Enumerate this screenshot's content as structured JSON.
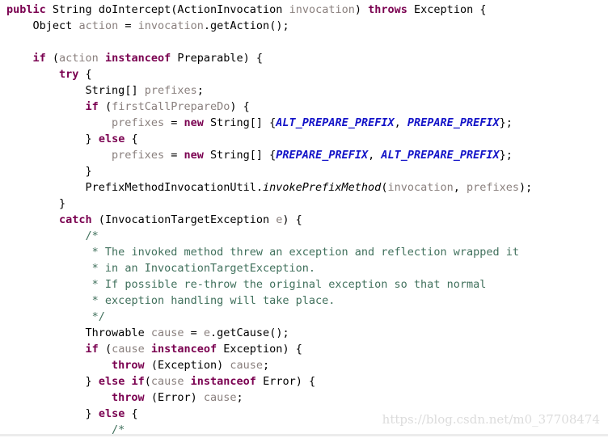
{
  "editor": {
    "language": "Java",
    "background": "#ffffff"
  },
  "theme": {
    "keyword": "#7a0050",
    "type": "#000000",
    "identifier": "#8a807e",
    "constant": "#1414c8",
    "comment": "#40705c",
    "punctuation": "#000000",
    "watermark": "#dcdcdc"
  },
  "watermark": {
    "text": "https://blog.csdn.net/m0_37708474"
  },
  "code": {
    "lines": [
      {
        "indent": 0,
        "tokens": [
          {
            "cls": "t-kw",
            "text": "public"
          },
          {
            "cls": "t-punc",
            "text": " "
          },
          {
            "cls": "t-type",
            "text": "String"
          },
          {
            "cls": "t-punc",
            "text": " "
          },
          {
            "cls": "t-type",
            "text": "doIntercept"
          },
          {
            "cls": "t-punc",
            "text": "("
          },
          {
            "cls": "t-type",
            "text": "ActionInvocation"
          },
          {
            "cls": "t-punc",
            "text": " "
          },
          {
            "cls": "t-ident",
            "text": "invocation"
          },
          {
            "cls": "t-punc",
            "text": ") "
          },
          {
            "cls": "t-kw",
            "text": "throws"
          },
          {
            "cls": "t-punc",
            "text": " "
          },
          {
            "cls": "t-type",
            "text": "Exception"
          },
          {
            "cls": "t-punc",
            "text": " {"
          }
        ]
      },
      {
        "indent": 4,
        "tokens": [
          {
            "cls": "t-type",
            "text": "Object"
          },
          {
            "cls": "t-punc",
            "text": " "
          },
          {
            "cls": "t-ident",
            "text": "action"
          },
          {
            "cls": "t-punc",
            "text": " = "
          },
          {
            "cls": "t-ident",
            "text": "invocation"
          },
          {
            "cls": "t-punc",
            "text": "."
          },
          {
            "cls": "t-type",
            "text": "getAction"
          },
          {
            "cls": "t-punc",
            "text": "();"
          }
        ]
      },
      {
        "indent": 0,
        "tokens": []
      },
      {
        "indent": 4,
        "tokens": [
          {
            "cls": "t-kw",
            "text": "if"
          },
          {
            "cls": "t-punc",
            "text": " ("
          },
          {
            "cls": "t-ident",
            "text": "action"
          },
          {
            "cls": "t-punc",
            "text": " "
          },
          {
            "cls": "t-kw",
            "text": "instanceof"
          },
          {
            "cls": "t-punc",
            "text": " "
          },
          {
            "cls": "t-type",
            "text": "Preparable"
          },
          {
            "cls": "t-punc",
            "text": ") {"
          }
        ]
      },
      {
        "indent": 8,
        "tokens": [
          {
            "cls": "t-kw",
            "text": "try"
          },
          {
            "cls": "t-punc",
            "text": " {"
          }
        ]
      },
      {
        "indent": 12,
        "tokens": [
          {
            "cls": "t-type",
            "text": "String"
          },
          {
            "cls": "t-punc",
            "text": "[] "
          },
          {
            "cls": "t-ident",
            "text": "prefixes"
          },
          {
            "cls": "t-punc",
            "text": ";"
          }
        ]
      },
      {
        "indent": 12,
        "tokens": [
          {
            "cls": "t-kw",
            "text": "if"
          },
          {
            "cls": "t-punc",
            "text": " ("
          },
          {
            "cls": "t-ident",
            "text": "firstCallPrepareDo"
          },
          {
            "cls": "t-punc",
            "text": ") {"
          }
        ]
      },
      {
        "indent": 16,
        "tokens": [
          {
            "cls": "t-ident",
            "text": "prefixes"
          },
          {
            "cls": "t-punc",
            "text": " = "
          },
          {
            "cls": "t-kw",
            "text": "new"
          },
          {
            "cls": "t-punc",
            "text": " "
          },
          {
            "cls": "t-type",
            "text": "String"
          },
          {
            "cls": "t-punc",
            "text": "[] {"
          },
          {
            "cls": "t-const",
            "text": "ALT_PREPARE_PREFIX"
          },
          {
            "cls": "t-punc",
            "text": ", "
          },
          {
            "cls": "t-const",
            "text": "PREPARE_PREFIX"
          },
          {
            "cls": "t-punc",
            "text": "};"
          }
        ]
      },
      {
        "indent": 12,
        "tokens": [
          {
            "cls": "t-punc",
            "text": "} "
          },
          {
            "cls": "t-kw",
            "text": "else"
          },
          {
            "cls": "t-punc",
            "text": " {"
          }
        ]
      },
      {
        "indent": 16,
        "tokens": [
          {
            "cls": "t-ident",
            "text": "prefixes"
          },
          {
            "cls": "t-punc",
            "text": " = "
          },
          {
            "cls": "t-kw",
            "text": "new"
          },
          {
            "cls": "t-punc",
            "text": " "
          },
          {
            "cls": "t-type",
            "text": "String"
          },
          {
            "cls": "t-punc",
            "text": "[] {"
          },
          {
            "cls": "t-const",
            "text": "PREPARE_PREFIX"
          },
          {
            "cls": "t-punc",
            "text": ", "
          },
          {
            "cls": "t-const",
            "text": "ALT_PREPARE_PREFIX"
          },
          {
            "cls": "t-punc",
            "text": "};"
          }
        ]
      },
      {
        "indent": 12,
        "tokens": [
          {
            "cls": "t-punc",
            "text": "}"
          }
        ]
      },
      {
        "indent": 12,
        "tokens": [
          {
            "cls": "t-type",
            "text": "PrefixMethodInvocationUtil"
          },
          {
            "cls": "t-punc",
            "text": "."
          },
          {
            "cls": "t-static",
            "text": "invokePrefixMethod"
          },
          {
            "cls": "t-punc",
            "text": "("
          },
          {
            "cls": "t-ident",
            "text": "invocation"
          },
          {
            "cls": "t-punc",
            "text": ", "
          },
          {
            "cls": "t-ident",
            "text": "prefixes"
          },
          {
            "cls": "t-punc",
            "text": ");"
          }
        ]
      },
      {
        "indent": 8,
        "tokens": [
          {
            "cls": "t-punc",
            "text": "}"
          }
        ]
      },
      {
        "indent": 8,
        "tokens": [
          {
            "cls": "t-kw",
            "text": "catch"
          },
          {
            "cls": "t-punc",
            "text": " ("
          },
          {
            "cls": "t-type",
            "text": "InvocationTargetException"
          },
          {
            "cls": "t-punc",
            "text": " "
          },
          {
            "cls": "t-ident",
            "text": "e"
          },
          {
            "cls": "t-punc",
            "text": ") {"
          }
        ]
      },
      {
        "indent": 12,
        "tokens": [
          {
            "cls": "t-cmt",
            "text": "/*"
          }
        ]
      },
      {
        "indent": 12,
        "tokens": [
          {
            "cls": "t-cmt",
            "text": " * The invoked method threw an exception and reflection wrapped it"
          }
        ]
      },
      {
        "indent": 12,
        "tokens": [
          {
            "cls": "t-cmt",
            "text": " * in an InvocationTargetException."
          }
        ]
      },
      {
        "indent": 12,
        "tokens": [
          {
            "cls": "t-cmt",
            "text": " * If possible re-throw the original exception so that normal"
          }
        ]
      },
      {
        "indent": 12,
        "tokens": [
          {
            "cls": "t-cmt",
            "text": " * exception handling will take place."
          }
        ]
      },
      {
        "indent": 12,
        "tokens": [
          {
            "cls": "t-cmt",
            "text": " */"
          }
        ]
      },
      {
        "indent": 12,
        "tokens": [
          {
            "cls": "t-type",
            "text": "Throwable"
          },
          {
            "cls": "t-punc",
            "text": " "
          },
          {
            "cls": "t-ident",
            "text": "cause"
          },
          {
            "cls": "t-punc",
            "text": " = "
          },
          {
            "cls": "t-ident",
            "text": "e"
          },
          {
            "cls": "t-punc",
            "text": "."
          },
          {
            "cls": "t-type",
            "text": "getCause"
          },
          {
            "cls": "t-punc",
            "text": "();"
          }
        ]
      },
      {
        "indent": 12,
        "tokens": [
          {
            "cls": "t-kw",
            "text": "if"
          },
          {
            "cls": "t-punc",
            "text": " ("
          },
          {
            "cls": "t-ident",
            "text": "cause"
          },
          {
            "cls": "t-punc",
            "text": " "
          },
          {
            "cls": "t-kw",
            "text": "instanceof"
          },
          {
            "cls": "t-punc",
            "text": " "
          },
          {
            "cls": "t-type",
            "text": "Exception"
          },
          {
            "cls": "t-punc",
            "text": ") {"
          }
        ]
      },
      {
        "indent": 16,
        "tokens": [
          {
            "cls": "t-kw",
            "text": "throw"
          },
          {
            "cls": "t-punc",
            "text": " ("
          },
          {
            "cls": "t-type",
            "text": "Exception"
          },
          {
            "cls": "t-punc",
            "text": ") "
          },
          {
            "cls": "t-ident",
            "text": "cause"
          },
          {
            "cls": "t-punc",
            "text": ";"
          }
        ]
      },
      {
        "indent": 12,
        "tokens": [
          {
            "cls": "t-punc",
            "text": "} "
          },
          {
            "cls": "t-kw",
            "text": "else"
          },
          {
            "cls": "t-punc",
            "text": " "
          },
          {
            "cls": "t-kw",
            "text": "if"
          },
          {
            "cls": "t-punc",
            "text": "("
          },
          {
            "cls": "t-ident",
            "text": "cause"
          },
          {
            "cls": "t-punc",
            "text": " "
          },
          {
            "cls": "t-kw",
            "text": "instanceof"
          },
          {
            "cls": "t-punc",
            "text": " "
          },
          {
            "cls": "t-type",
            "text": "Error"
          },
          {
            "cls": "t-punc",
            "text": ") {"
          }
        ]
      },
      {
        "indent": 16,
        "tokens": [
          {
            "cls": "t-kw",
            "text": "throw"
          },
          {
            "cls": "t-punc",
            "text": " ("
          },
          {
            "cls": "t-type",
            "text": "Error"
          },
          {
            "cls": "t-punc",
            "text": ") "
          },
          {
            "cls": "t-ident",
            "text": "cause"
          },
          {
            "cls": "t-punc",
            "text": ";"
          }
        ]
      },
      {
        "indent": 12,
        "tokens": [
          {
            "cls": "t-punc",
            "text": "} "
          },
          {
            "cls": "t-kw",
            "text": "else"
          },
          {
            "cls": "t-punc",
            "text": " {"
          }
        ]
      },
      {
        "indent": 16,
        "tokens": [
          {
            "cls": "t-cmt",
            "text": "/*"
          }
        ]
      }
    ]
  }
}
